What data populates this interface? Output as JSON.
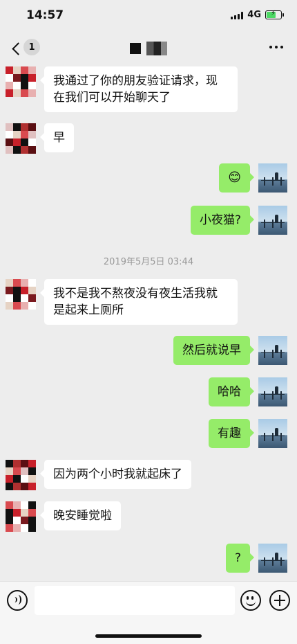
{
  "status": {
    "time": "14:57",
    "network": "4G",
    "battery_level": 0.7
  },
  "nav": {
    "unread_count": "1"
  },
  "messages": [
    {
      "side": "left",
      "text": "我通过了你的朋友验证请求，现在我们可以开始聊天了"
    },
    {
      "side": "left",
      "text": "早"
    },
    {
      "side": "right",
      "text": "😊"
    },
    {
      "side": "right",
      "text": "小夜猫?"
    },
    {
      "side": "left",
      "text": "我不是我不熬夜没有夜生活我就是起来上厕所"
    },
    {
      "side": "right",
      "text": "然后就说早"
    },
    {
      "side": "right",
      "text": "哈哈"
    },
    {
      "side": "right",
      "text": "有趣"
    },
    {
      "side": "left",
      "text": "因为两个小时我就起床了"
    },
    {
      "side": "left",
      "text": "晚安睡觉啦"
    },
    {
      "side": "right",
      "text": "?"
    }
  ],
  "timestamp": "2019年5月5日 03:44",
  "colors": {
    "background": "#ededed",
    "sent_bubble": "#95ec69",
    "received_bubble": "#ffffff"
  }
}
